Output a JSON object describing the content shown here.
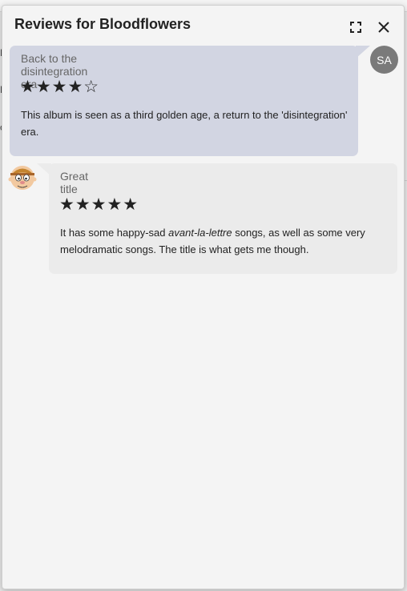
{
  "background": {
    "fragments": [
      "F",
      "F",
      "c"
    ]
  },
  "modal": {
    "title": "Reviews for Bloodflowers",
    "expand_icon": "expand-icon",
    "close_icon": "close-icon"
  },
  "reviews": [
    {
      "title": "Back to the disintegration era",
      "stars": "★★★★☆",
      "rating": 4,
      "rating_max": 5,
      "body": "This album is seen as a third golden age, a return to the 'disintegration' era.",
      "avatar_initials": "SA",
      "bubble_color": "#d2d5e2"
    },
    {
      "title": "Great title",
      "stars": "★★★★★",
      "rating": 5,
      "rating_max": 5,
      "body_before": "It has some happy-sad ",
      "body_emphasis": "avant-la-lettre",
      "body_after": " songs, as well as some very melodramatic songs. The title is what gets me though.",
      "avatar_icon": "cartoon-avatar-icon",
      "bubble_color": "#ebebeb"
    }
  ]
}
